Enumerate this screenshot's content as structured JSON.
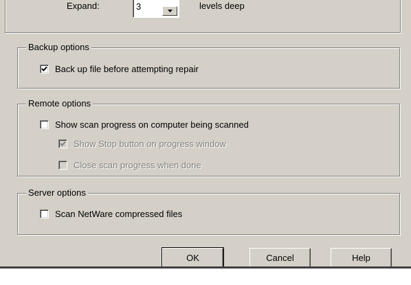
{
  "expand": {
    "label": "Expand:",
    "value": "3",
    "suffix": "levels deep"
  },
  "backup_options": {
    "title": "Backup options",
    "items": [
      {
        "label": "Back up file before attempting repair",
        "checked": true,
        "enabled": true
      }
    ]
  },
  "remote_options": {
    "title": "Remote options",
    "items": [
      {
        "label": "Show scan progress on computer being scanned",
        "checked": false,
        "enabled": true
      },
      {
        "label": "Show Stop button on progress window",
        "checked": true,
        "enabled": false
      },
      {
        "label": "Close scan progress when done",
        "checked": false,
        "enabled": false
      }
    ]
  },
  "server_options": {
    "title": "Server options",
    "items": [
      {
        "label": "Scan NetWare compressed files",
        "checked": false,
        "enabled": true
      }
    ]
  },
  "buttons": {
    "ok": "OK",
    "cancel": "Cancel",
    "help": "Help"
  },
  "colors": {
    "face": "#d4d0c8",
    "shadow": "#808080",
    "highlight": "#ffffff",
    "disabled_text": "#808080"
  },
  "icons": {
    "check": "check-icon",
    "spin_down": "spin-down-arrow-icon"
  }
}
